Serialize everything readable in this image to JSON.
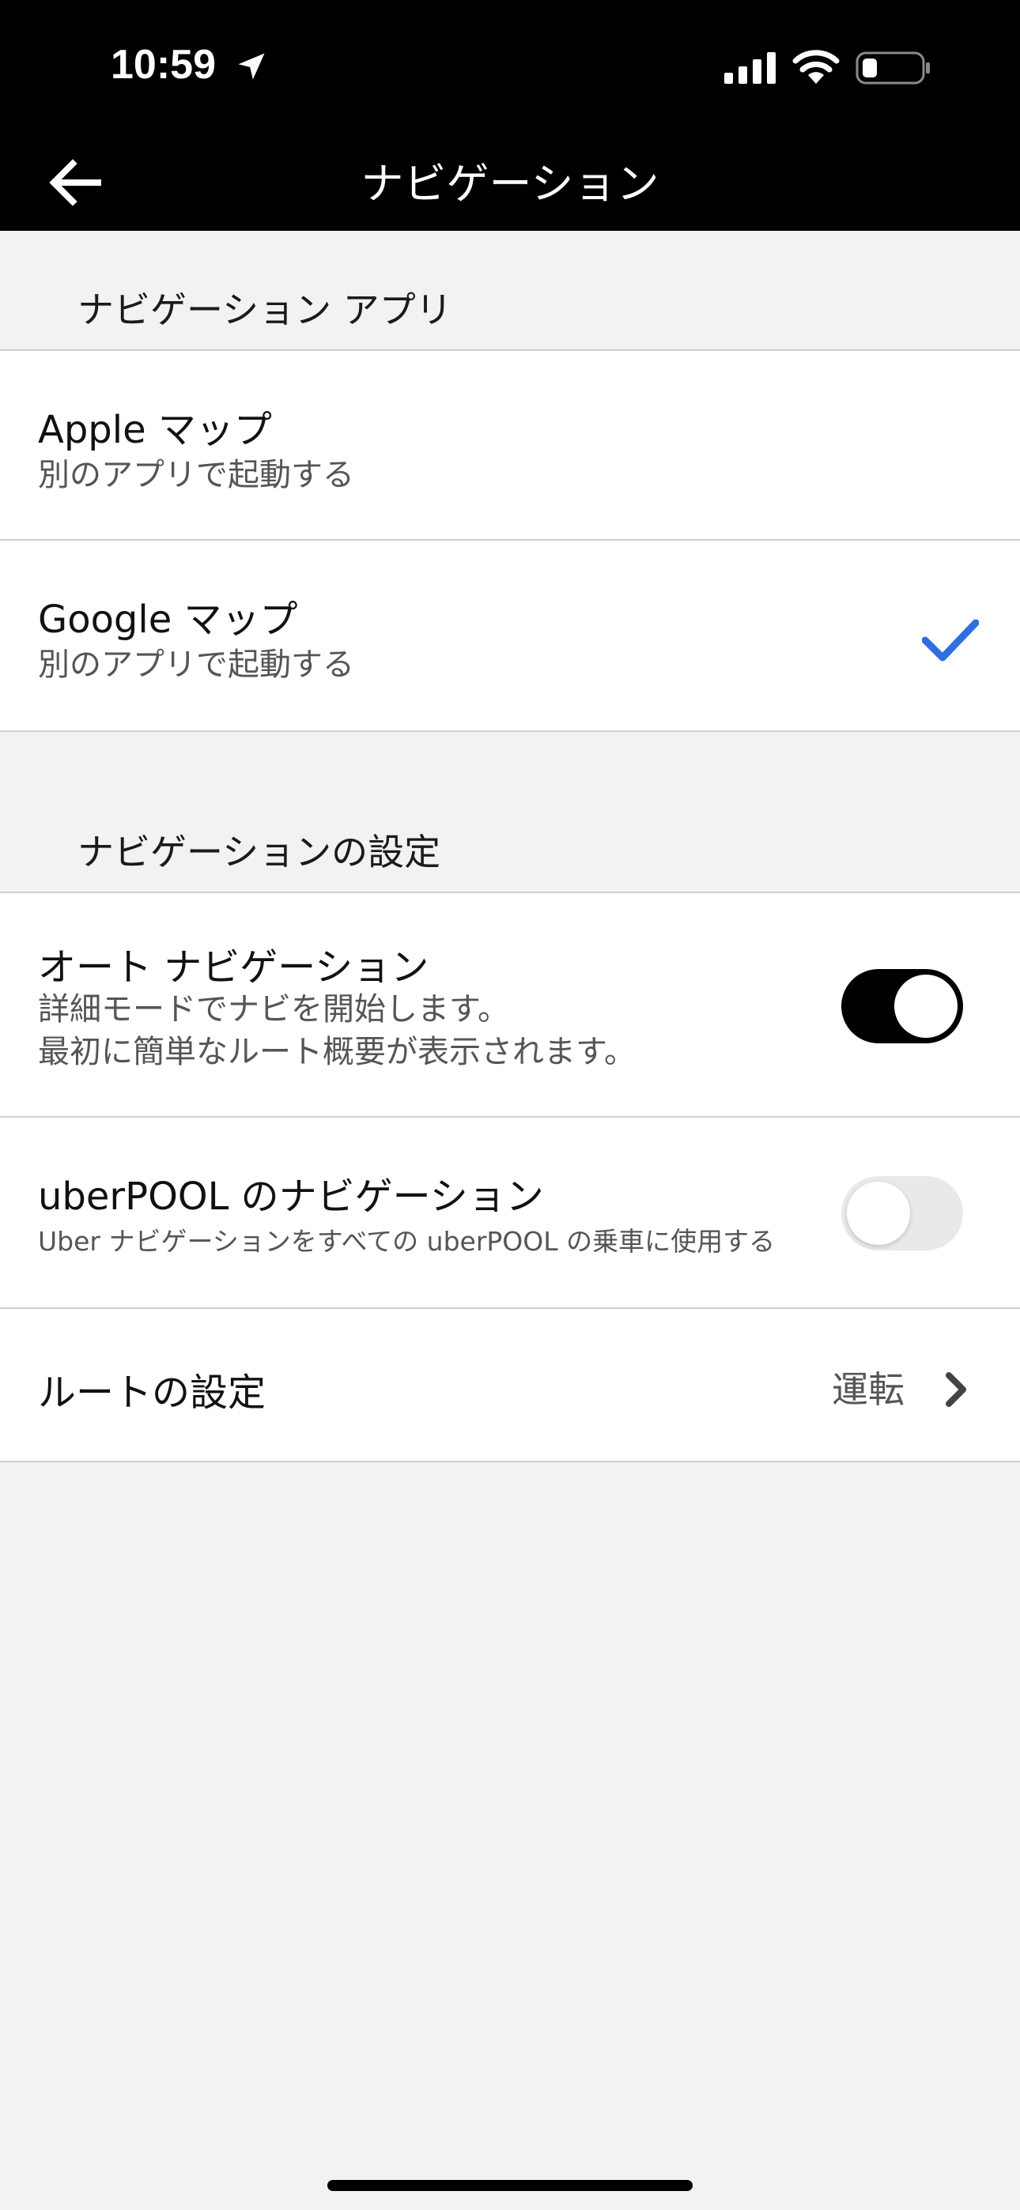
{
  "status_bar": {
    "time": "10:59"
  },
  "nav": {
    "title": "ナビゲーション"
  },
  "sections": {
    "nav_apps": {
      "header": "ナビゲーション アプリ",
      "items": [
        {
          "title": "Apple マップ",
          "subtitle": "別のアプリで起動する",
          "selected": false
        },
        {
          "title": "Google マップ",
          "subtitle": "別のアプリで起動する",
          "selected": true
        }
      ]
    },
    "nav_settings": {
      "header": "ナビゲーションの設定",
      "auto_nav": {
        "title": "オート ナビゲーション",
        "subtitle_line1": "詳細モードでナビを開始します。",
        "subtitle_line2": "最初に簡単なルート概要が表示されます。",
        "enabled": true
      },
      "uberpool_nav": {
        "title": "uberPOOL のナビゲーション",
        "subtitle": "Uber ナビゲーションをすべての uberPOOL の乗車に使用する",
        "enabled": false
      },
      "route": {
        "title": "ルートの設定",
        "value": "運転"
      }
    }
  },
  "colors": {
    "header_bg": "#000000",
    "page_bg": "#f2f2f2",
    "accent_check": "#2f6fe0",
    "toggle_on": "#000000",
    "toggle_off": "#e9e9e9"
  },
  "icons": [
    "location-arrow-icon",
    "cellular-signal-icon",
    "wifi-icon",
    "battery-icon",
    "back-arrow-icon",
    "checkmark-icon",
    "chevron-right-icon"
  ]
}
